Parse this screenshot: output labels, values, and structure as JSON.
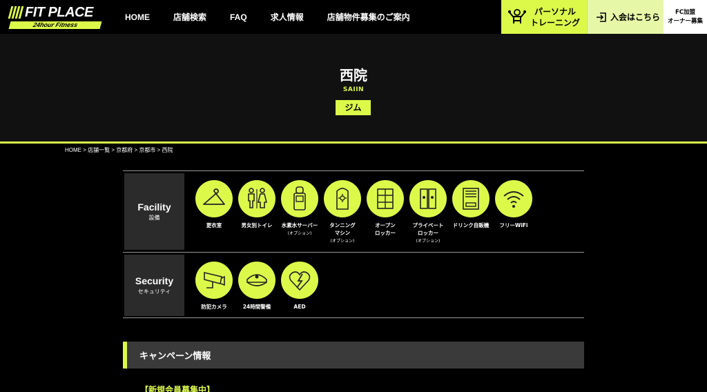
{
  "header": {
    "logo_main": "FIT PLACE",
    "logo_sub": "24hour Fitness",
    "nav": [
      "HOME",
      "店舗検索",
      "FAQ",
      "求人情報",
      "店舗物件募集のご案内"
    ],
    "personal_training": "パーソナル\nトレーニング",
    "join": "入会はこちら",
    "fc": "FC加盟\nオーナー募集"
  },
  "hero": {
    "title": "西院",
    "roman": "SAIIN",
    "tag": "ジム"
  },
  "breadcrumb": "HOME > 店舗一覧 > 京都府 > 京都市 > 西院",
  "facility": {
    "title_en": "Facility",
    "title_jp": "設備",
    "items": [
      {
        "label": "更衣室",
        "note": "",
        "icon": "hanger-icon"
      },
      {
        "label": "男女別トイレ",
        "note": "",
        "icon": "restroom-icon"
      },
      {
        "label": "水素水サーバー",
        "note": "(オプション)",
        "icon": "water-server-icon"
      },
      {
        "label": "タンニング\nマシン",
        "note": "(オプション)",
        "icon": "tanning-machine-icon"
      },
      {
        "label": "オープン\nロッカー",
        "note": "",
        "icon": "open-locker-icon"
      },
      {
        "label": "プライベート\nロッカー",
        "note": "(オプション)",
        "icon": "private-locker-icon"
      },
      {
        "label": "ドリンク自販機",
        "note": "",
        "icon": "vending-machine-icon"
      },
      {
        "label": "フリーWiFi",
        "note": "",
        "icon": "wifi-icon"
      }
    ]
  },
  "security": {
    "title_en": "Security",
    "title_jp": "セキュリティ",
    "items": [
      {
        "label": "防犯カメラ",
        "icon": "security-camera-icon"
      },
      {
        "label": "24時間警備",
        "icon": "guard-cap-icon"
      },
      {
        "label": "AED",
        "icon": "aed-icon"
      }
    ]
  },
  "campaign": {
    "heading": "キャンペーン情報",
    "sub": "【新規会員募集中】"
  },
  "colors": {
    "accent": "#dcf94a",
    "background": "#000000",
    "hero_bg": "#111111",
    "panel": "#2b2b2b"
  }
}
